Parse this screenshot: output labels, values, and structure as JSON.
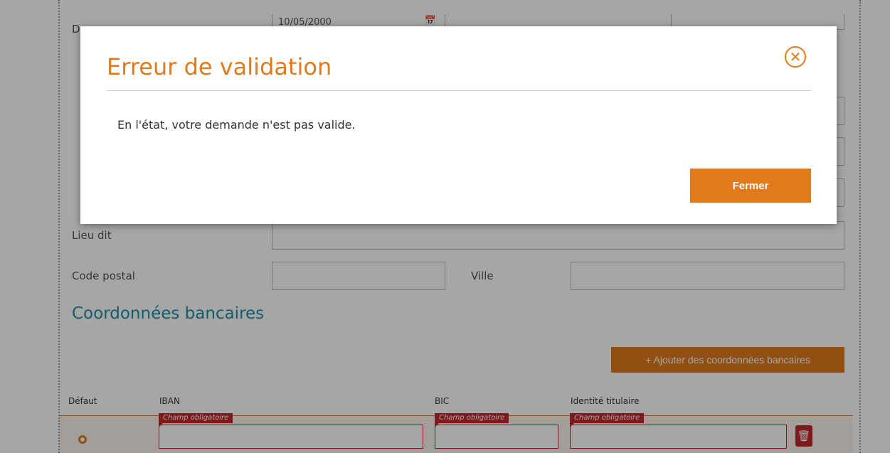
{
  "form": {
    "date_label": "D",
    "date_value": "10/05/2000",
    "lieu_dit_label": "Lieu dit",
    "code_postal_label": "Code postal",
    "ville_label": "Ville"
  },
  "section_bank": {
    "title": "Coordonnées bancaires",
    "add_button": "+ Ajouter des coordonnées bancaires",
    "columns": [
      "Défaut",
      "IBAN",
      "BIC",
      "Identité titulaire"
    ],
    "required_tag": "Champ obligatoire"
  },
  "modal": {
    "title": "Erreur de validation",
    "message": "En l'état, votre demande n'est pas valide.",
    "close_button": "Fermer"
  },
  "colors": {
    "accent": "#e07a1c",
    "section_title": "#1b8fa6",
    "error": "#c0282d"
  },
  "icons": {
    "calendar": "calendar-icon",
    "close": "close-icon",
    "trash": "trash-icon"
  }
}
